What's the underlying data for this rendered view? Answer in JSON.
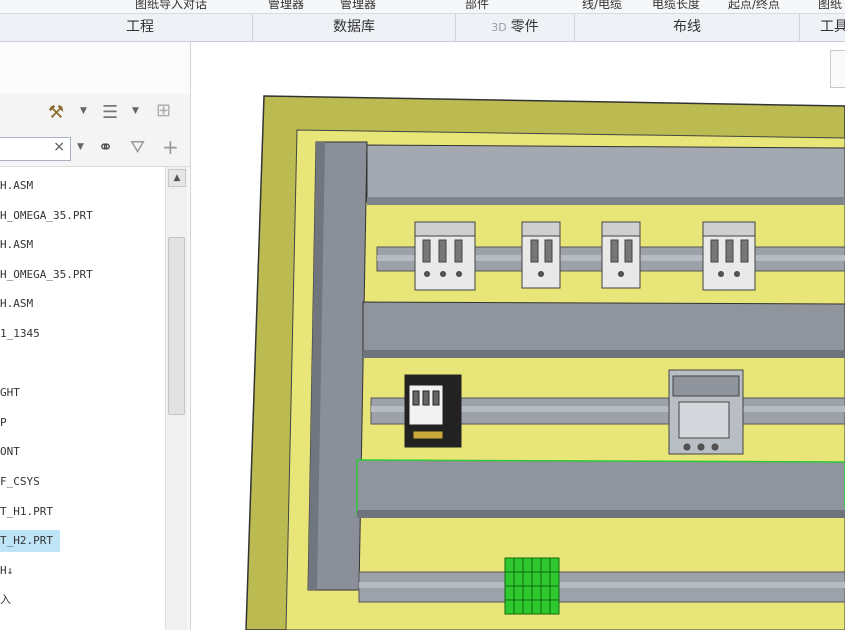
{
  "ribbon": {
    "commands": [
      "图纸导入对话",
      "管理器",
      "管理器",
      "部件",
      "线/电缆",
      "电缆长度",
      "起点/终点",
      "图纸"
    ],
    "groups": [
      {
        "label": "工程",
        "prefix": ""
      },
      {
        "label": "数据库",
        "prefix": ""
      },
      {
        "label": "零件",
        "prefix": "3D"
      },
      {
        "label": "布线",
        "prefix": ""
      },
      {
        "label": "工具",
        "prefix": ""
      }
    ]
  },
  "panel": {
    "search_clear_glyph": "×",
    "tree_items": [
      {
        "label": "H.ASM",
        "selected": false
      },
      {
        "label": "H_OMEGA_35.PRT",
        "selected": false
      },
      {
        "label": "H.ASM",
        "selected": false
      },
      {
        "label": "H_OMEGA_35.PRT",
        "selected": false
      },
      {
        "label": "H.ASM",
        "selected": false
      },
      {
        "label": "1_1345",
        "selected": false
      },
      {
        "label": "",
        "selected": false
      },
      {
        "label": "GHT",
        "selected": false
      },
      {
        "label": "P",
        "selected": false
      },
      {
        "label": "ONT",
        "selected": false
      },
      {
        "label": "F_CSYS",
        "selected": false
      },
      {
        "label": "T_H1.PRT",
        "selected": false
      },
      {
        "label": "T_H2.PRT",
        "selected": true
      },
      {
        "label": "H↓",
        "selected": false
      },
      {
        "label": "入",
        "selected": false
      }
    ],
    "icons": [
      "tools-icon",
      "dropdown-icon",
      "list-settings-icon",
      "dropdown-icon",
      "show-hide-icon",
      "binoculars-icon",
      "filter-icon",
      "add-icon"
    ]
  },
  "colors": {
    "enclosure": "#e8e678",
    "enclosure_dark": "#bcbb52",
    "duct": "#8a8f99",
    "duct_light": "#a3a8b1",
    "rail": "#9ca1aa",
    "terminal_green": "#2fc82f",
    "selection": "#bfe3f7"
  }
}
